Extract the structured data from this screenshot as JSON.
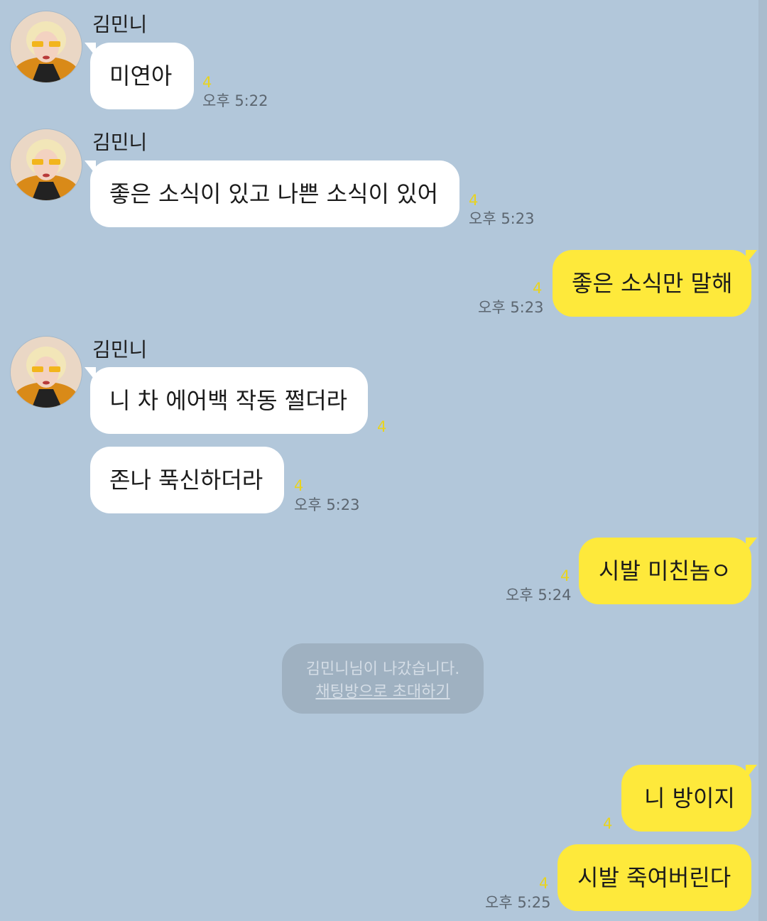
{
  "chat": {
    "partner_name": "김민니",
    "messages": [
      {
        "text": "미연아",
        "unread": "4",
        "time": "오후 5:22"
      },
      {
        "text": "좋은 소식이 있고 나쁜 소식이 있어",
        "unread": "4",
        "time": "오후 5:23"
      },
      {
        "text": "좋은 소식만 말해",
        "unread": "4",
        "time": "오후 5:23"
      },
      {
        "text": "니 차 에어백 작동 쩔더라",
        "unread": "4"
      },
      {
        "text": "존나 푹신하더라",
        "unread": "4",
        "time": "오후 5:23"
      },
      {
        "text": "시발 미친놈ㅇ",
        "unread": "4",
        "time": "오후 5:24"
      },
      {
        "text": "니 방이지",
        "unread": "4"
      },
      {
        "text": "시발 죽여버린다",
        "unread": "4",
        "time": "오후 5:25"
      }
    ],
    "system_notice": {
      "text": "김민니님이 나갔습니다.",
      "link": "채팅방으로 초대하기"
    }
  },
  "colors": {
    "background": "#b2c7da",
    "incoming_bubble": "#ffffff",
    "outgoing_bubble": "#fee93b",
    "unread_count": "#e8d320",
    "timestamp": "#5c6670"
  },
  "icons": {
    "avatar": "profile-photo-blonde-woman-yellow-sunglasses"
  }
}
